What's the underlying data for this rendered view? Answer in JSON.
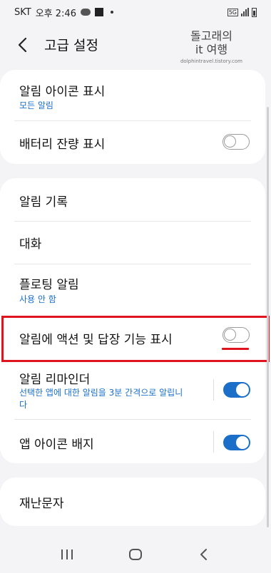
{
  "status_bar": {
    "carrier": "SKT",
    "time": "오후 2:46",
    "network": "5G"
  },
  "header": {
    "title": "고급 설정",
    "watermark_line1": "돌고래의",
    "watermark_line2": "it 여행",
    "watermark_url": "dolphintravel.tistory.com"
  },
  "card1": {
    "notification_icons": {
      "title": "알림 아이콘 표시",
      "value": "모든 알림"
    },
    "battery_percent": {
      "title": "배터리 잔량 표시",
      "enabled": false
    }
  },
  "card2": {
    "notification_history": {
      "title": "알림 기록"
    },
    "conversations": {
      "title": "대화"
    },
    "floating_notifications": {
      "title": "플로팅 알림",
      "value": "사용 안 함"
    },
    "suggest_actions": {
      "title": "알림에 액션 및 답장 기능 표시",
      "enabled": false
    },
    "reminders": {
      "title": "알림 리마인더",
      "description": "선택한 앱에 대한 알림을 3분 간격으로 알립니다",
      "enabled": true
    },
    "app_icon_badges": {
      "title": "앱 아이콘 배지",
      "enabled": true
    }
  },
  "card3": {
    "emergency_alerts": {
      "title": "재난문자"
    }
  },
  "colors": {
    "accent": "#1b6fc9",
    "highlight": "#e0141e",
    "background": "#f4f4f6"
  }
}
